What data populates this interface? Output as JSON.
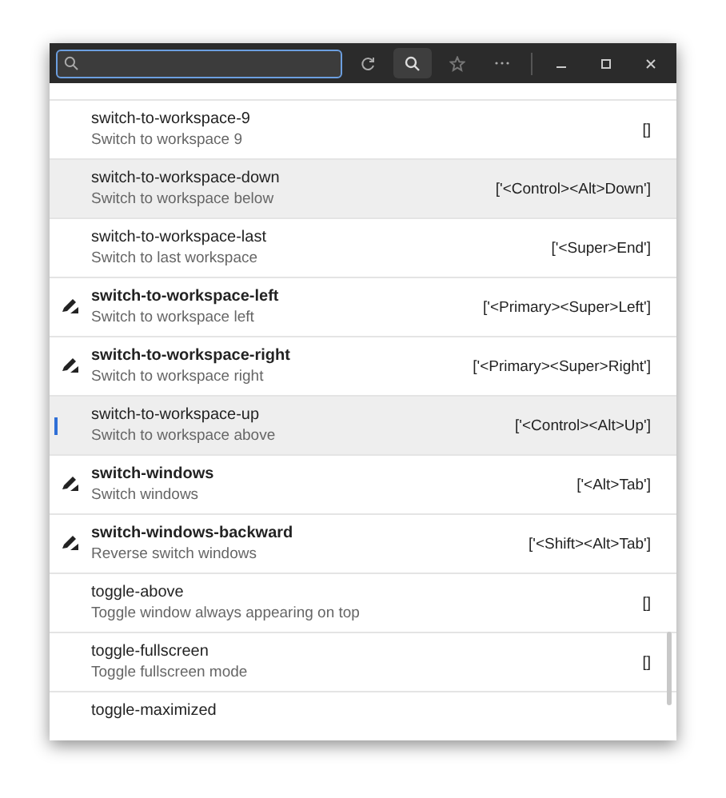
{
  "rows": [
    {
      "name": "switch-to-workspace-9",
      "description": "Switch to workspace 9",
      "value": "[]",
      "modified": false,
      "highlighted": false,
      "focused": false
    },
    {
      "name": "switch-to-workspace-down",
      "description": "Switch to workspace below",
      "value": "['<Control><Alt>Down']",
      "modified": false,
      "highlighted": true,
      "focused": false
    },
    {
      "name": "switch-to-workspace-last",
      "description": "Switch to last workspace",
      "value": "['<Super>End']",
      "modified": false,
      "highlighted": false,
      "focused": false
    },
    {
      "name": "switch-to-workspace-left",
      "description": "Switch to workspace left",
      "value": "['<Primary><Super>Left']",
      "modified": true,
      "highlighted": false,
      "focused": false
    },
    {
      "name": "switch-to-workspace-right",
      "description": "Switch to workspace right",
      "value": "['<Primary><Super>Right']",
      "modified": true,
      "highlighted": false,
      "focused": false
    },
    {
      "name": "switch-to-workspace-up",
      "description": "Switch to workspace above",
      "value": "['<Control><Alt>Up']",
      "modified": false,
      "highlighted": true,
      "focused": true
    },
    {
      "name": "switch-windows",
      "description": "Switch windows",
      "value": "['<Alt>Tab']",
      "modified": true,
      "highlighted": false,
      "focused": false
    },
    {
      "name": "switch-windows-backward",
      "description": "Reverse switch windows",
      "value": "['<Shift><Alt>Tab']",
      "modified": true,
      "highlighted": false,
      "focused": false
    },
    {
      "name": "toggle-above",
      "description": "Toggle window always appearing on top",
      "value": "[]",
      "modified": false,
      "highlighted": false,
      "focused": false
    },
    {
      "name": "toggle-fullscreen",
      "description": "Toggle fullscreen mode",
      "value": "[]",
      "modified": false,
      "highlighted": false,
      "focused": false
    },
    {
      "name": "toggle-maximized",
      "modified": false,
      "highlighted": false,
      "focused": false
    }
  ]
}
